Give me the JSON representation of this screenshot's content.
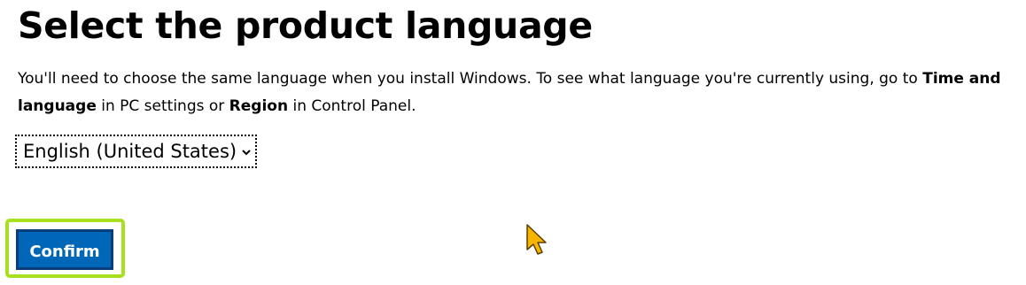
{
  "page": {
    "title": "Select the product language"
  },
  "description": {
    "part1": "You'll need to choose the same language when you install Windows. To see what language you're currently using, go to ",
    "bold1": "Time and language",
    "part2": " in PC settings or ",
    "bold2": "Region",
    "part3": " in Control Panel."
  },
  "language_select": {
    "selected": "English (United States)",
    "icon": "chevron-down-icon"
  },
  "confirm_button": {
    "label": "Confirm",
    "color": "#0067b8",
    "highlight_color": "#a6e01e"
  },
  "cursor": {
    "icon": "arrow-pointer-icon",
    "color": "#f7b500"
  }
}
